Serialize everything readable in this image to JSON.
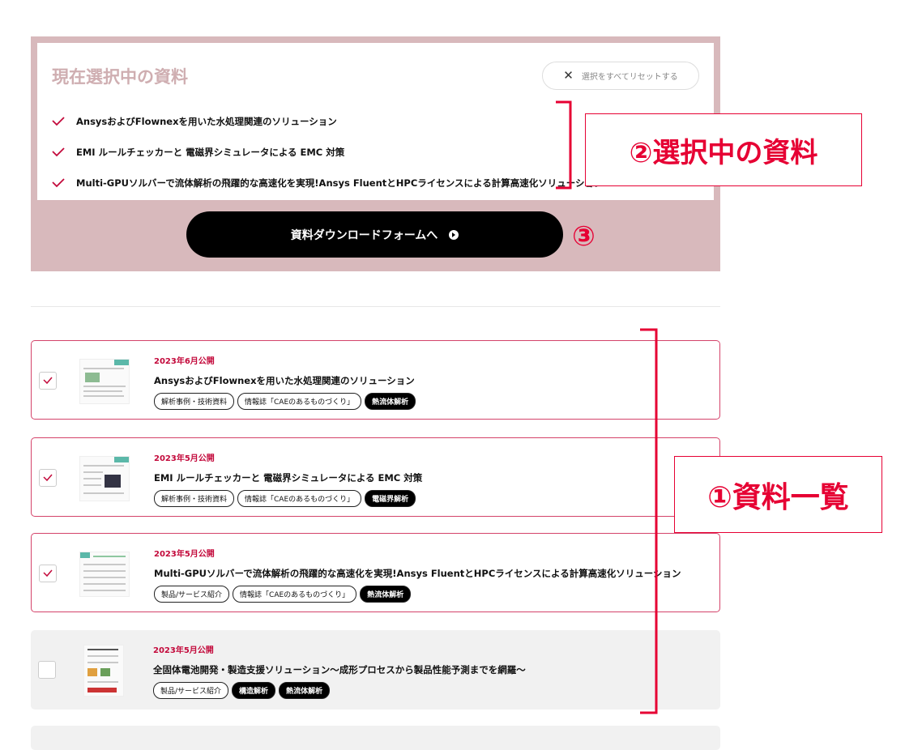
{
  "selection": {
    "title": "現在選択中の資料",
    "reset_label": "選択をすべてリセットする",
    "items": [
      {
        "label": "AnsysおよびFlownexを用いた水処理関連のソリューション"
      },
      {
        "label": "EMI ルールチェッカーと 電磁界シミュレータによる EMC 対策"
      },
      {
        "label": "Multi-GPUソルバーで流体解析の飛躍的な高速化を実現!Ansys FluentとHPCライセンスによる計算高速化ソリューション"
      }
    ],
    "download_label": "資料ダウンロードフォームへ"
  },
  "annotations": {
    "selected_docs": "②選択中の資料",
    "step3": "③",
    "doc_list": "①資料一覧"
  },
  "documents": [
    {
      "date": "2023年6月公開",
      "title": "AnsysおよびFlownexを用いた水処理関連のソリューション",
      "tags": [
        "解析事例・技術資料",
        "情報誌「CAEのあるものづくり」",
        "熱流体解析"
      ],
      "checked": true
    },
    {
      "date": "2023年5月公開",
      "title": "EMI ルールチェッカーと 電磁界シミュレータによる EMC 対策",
      "tags": [
        "解析事例・技術資料",
        "情報誌「CAEのあるものづくり」",
        "電磁界解析"
      ],
      "checked": true
    },
    {
      "date": "2023年5月公開",
      "title": "Multi-GPUソルバーで流体解析の飛躍的な高速化を実現!Ansys FluentとHPCライセンスによる計算高速化ソリューション",
      "tags": [
        "製品/サービス紹介",
        "情報誌「CAEのあるものづくり」",
        "熱流体解析"
      ],
      "checked": true
    },
    {
      "date": "2023年5月公開",
      "title": "全固体電池開発・製造支援ソリューション〜成形プロセスから製品性能予測までを網羅〜",
      "tags": [
        "製品/サービス紹介",
        "構造解析",
        "熱流体解析"
      ],
      "checked": false
    }
  ],
  "colors": {
    "accent": "#c3093b",
    "annotation": "#e60033",
    "panel_bg": "#d8b9bc"
  }
}
